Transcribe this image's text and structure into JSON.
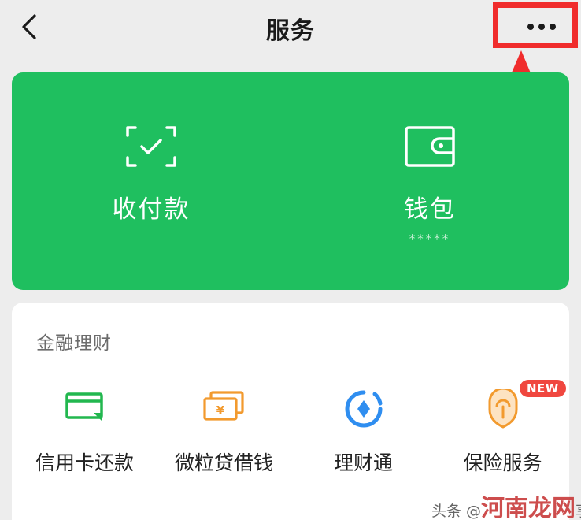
{
  "header": {
    "title": "服务"
  },
  "wallet_panel": {
    "items": [
      {
        "label": "收付款",
        "sub": ""
      },
      {
        "label": "钱包",
        "sub": "*****"
      }
    ]
  },
  "finance": {
    "title": "金融理财",
    "items": [
      {
        "label": "信用卡还款",
        "badge": ""
      },
      {
        "label": "微粒贷借钱",
        "badge": ""
      },
      {
        "label": "理财通",
        "badge": ""
      },
      {
        "label": "保险服务",
        "badge": "NEW"
      }
    ]
  },
  "watermark": {
    "prefix": "头条 @",
    "brand": "河南龙网",
    "suffix": "享"
  },
  "colors": {
    "green": "#1fbf5f",
    "annotation_red": "#f02c2c",
    "badge_red": "#f0473f",
    "icon_green": "#22b74f",
    "icon_orange": "#f29a2e",
    "icon_blue": "#2f8ef0"
  }
}
